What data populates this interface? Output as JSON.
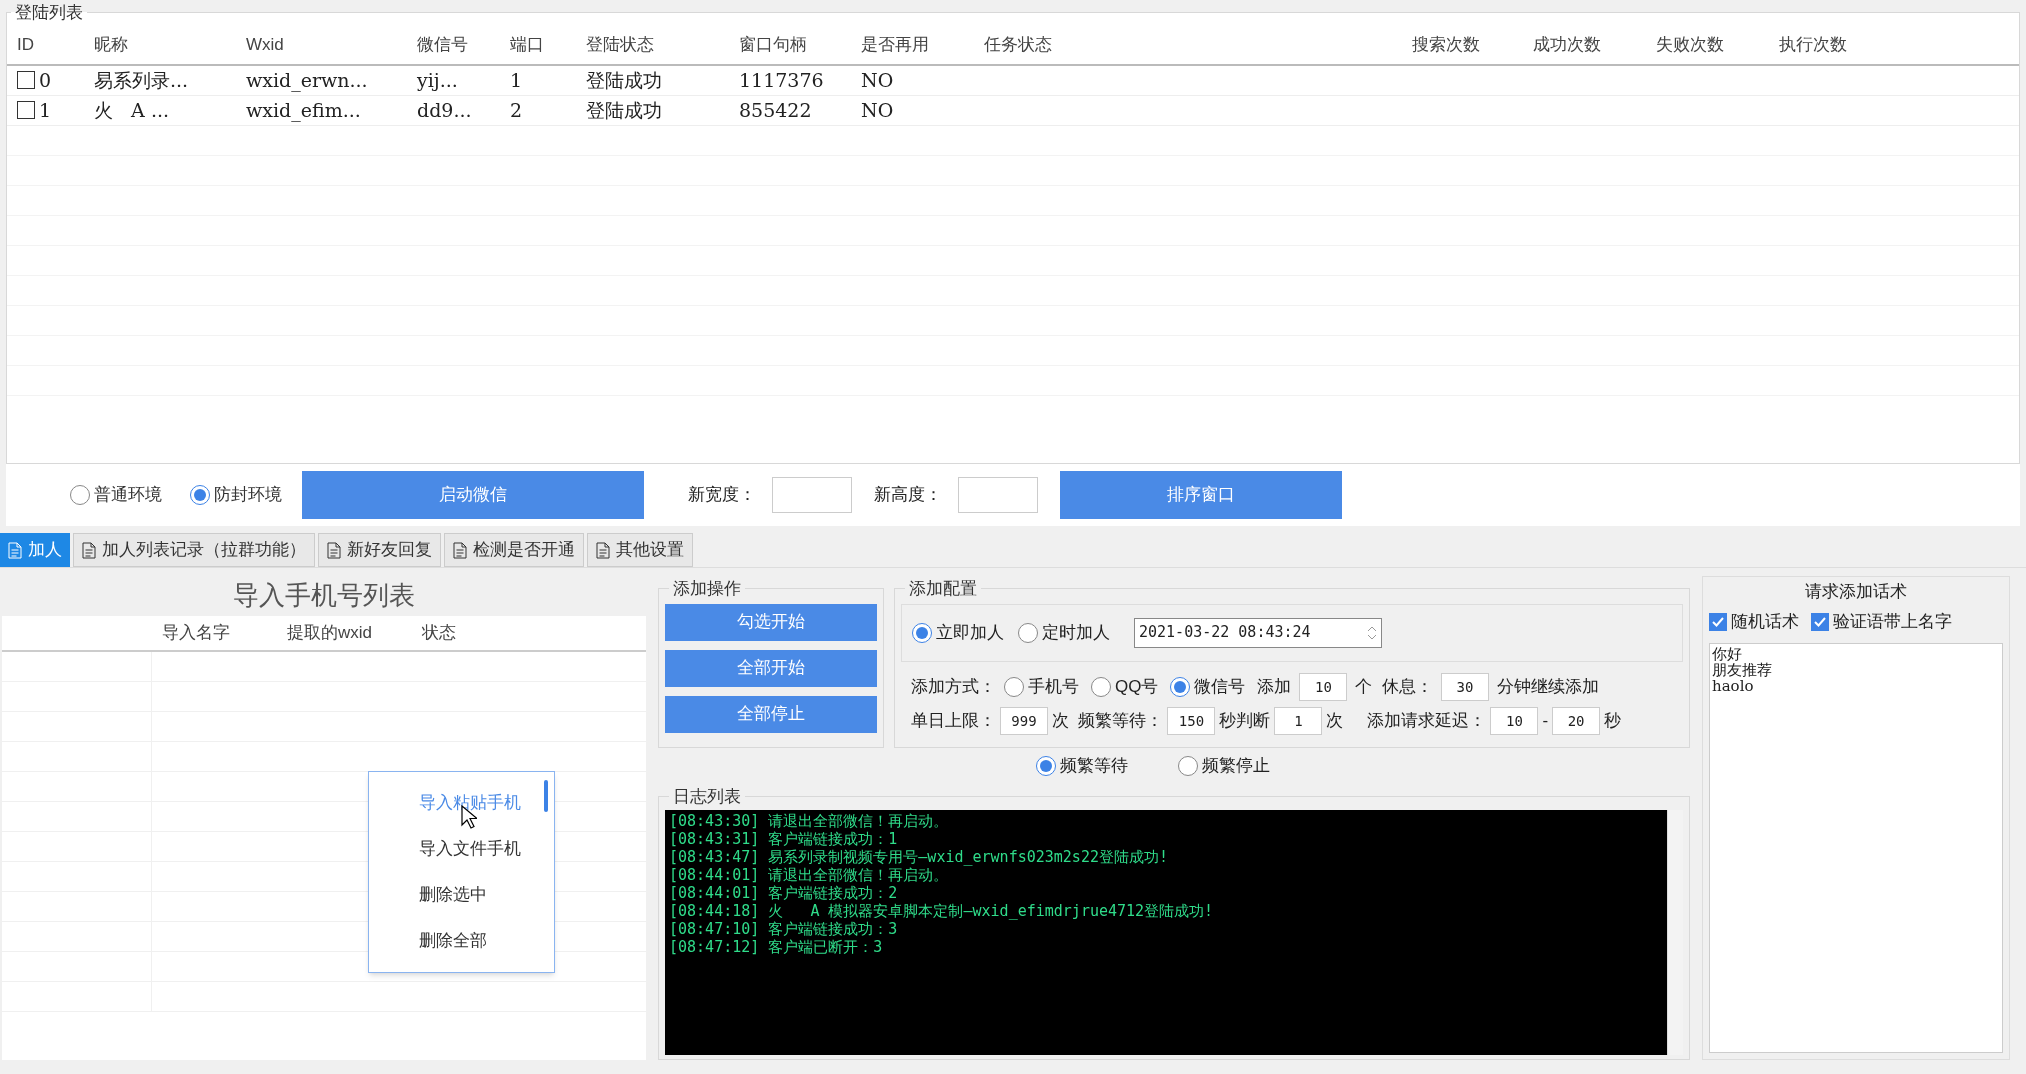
{
  "login_list": {
    "title": "登陆列表",
    "columns": [
      "ID",
      "昵称",
      "Wxid",
      "微信号",
      "端口",
      "登陆状态",
      "窗口句柄",
      "是否再用",
      "任务状态",
      "搜索次数",
      "成功次数",
      "失败次数",
      "执行次数"
    ],
    "rows": [
      {
        "checked": false,
        "cells": [
          "0",
          "易系列录...",
          "wxid_erwn...",
          "yij...",
          "1",
          "登陆成功",
          "1117376",
          "NO",
          "",
          "",
          "",
          "",
          ""
        ]
      },
      {
        "checked": false,
        "cells": [
          "1",
          "火   A ...",
          "wxid_efim...",
          "dd9...",
          "2",
          "登陆成功",
          "855422",
          "NO",
          "",
          "",
          "",
          "",
          ""
        ]
      }
    ]
  },
  "env_options": [
    {
      "label": "普通环境",
      "selected": false
    },
    {
      "label": "防封环境",
      "selected": true
    }
  ],
  "start_button": "启动微信",
  "width_label": "新宽度：",
  "height_label": "新高度：",
  "sort_button": "排序窗口",
  "tabs": [
    {
      "label": "加人",
      "selected": true
    },
    {
      "label": "加人列表记录（拉群功能）",
      "selected": false
    },
    {
      "label": "新好友回复",
      "selected": false
    },
    {
      "label": "检测是否开通",
      "selected": false
    },
    {
      "label": "其他设置",
      "selected": false
    }
  ],
  "phone_list": {
    "title": "导入手机号列表",
    "columns": [
      "",
      "导入名字",
      "提取的wxid",
      "状态"
    ]
  },
  "context_menu": [
    {
      "label": "导入粘贴手机",
      "selected": true
    },
    {
      "label": "导入文件手机",
      "selected": false
    },
    {
      "label": "删除选中",
      "selected": false
    },
    {
      "label": "删除全部",
      "selected": false
    }
  ],
  "add_ops": {
    "title": "添加操作",
    "buttons": [
      "勾选开始",
      "全部开始",
      "全部停止"
    ]
  },
  "add_config": {
    "title": "添加配置",
    "timing": [
      {
        "label": "立即加人",
        "selected": true
      },
      {
        "label": "定时加人",
        "selected": false
      }
    ],
    "datetime": "2021-03-22 08:43:24",
    "method_label": "添加方式：",
    "methods": [
      {
        "label": "手机号",
        "selected": false
      },
      {
        "label": "QQ号",
        "selected": false
      },
      {
        "label": "微信号",
        "selected": true
      }
    ],
    "row1": [
      {
        "kind": "text",
        "text": "添加"
      },
      {
        "kind": "input",
        "value": "10"
      },
      {
        "kind": "text",
        "text": "个  休息："
      },
      {
        "kind": "input",
        "value": "30"
      },
      {
        "kind": "text",
        "text": "分钟继续添加"
      }
    ],
    "row2": [
      {
        "kind": "text",
        "text": "单日上限："
      },
      {
        "kind": "input",
        "value": "999"
      },
      {
        "kind": "text",
        "text": "次  频繁等待："
      },
      {
        "kind": "input",
        "value": "150"
      },
      {
        "kind": "text",
        "text": "秒判断"
      },
      {
        "kind": "input",
        "value": "1"
      },
      {
        "kind": "text",
        "text": "次"
      },
      {
        "kind": "gap"
      },
      {
        "kind": "text",
        "text": "添加请求延迟："
      },
      {
        "kind": "input",
        "value": "10"
      },
      {
        "kind": "text",
        "text": "-"
      },
      {
        "kind": "input",
        "value": "20"
      },
      {
        "kind": "text",
        "text": "秒"
      }
    ]
  },
  "freq_options": [
    {
      "label": "频繁等待",
      "selected": true
    },
    {
      "label": "频繁停止",
      "selected": false
    }
  ],
  "log": {
    "title": "日志列表",
    "lines": [
      "[08:43:30] 请退出全部微信！再启动。",
      "[08:43:31] 客户端链接成功：1",
      "[08:43:47] 易系列录制视频专用号—wxid_erwnfs023m2s22登陆成功!",
      "[08:44:01] 请退出全部微信！再启动。",
      "[08:44:01] 客户端链接成功：2",
      "[08:44:18] 火   A 模拟器安卓脚本定制—wxid_efimdrjrue4712登陆成功!",
      "[08:47:10] 客户端链接成功：3",
      "[08:47:12] 客户端已断开：3"
    ]
  },
  "phrases": {
    "title": "请求添加话术",
    "options": [
      {
        "label": "随机话术",
        "checked": true
      },
      {
        "label": "验证语带上名字",
        "checked": true
      }
    ],
    "lines": [
      "你好",
      "朋友推荐",
      "haolo"
    ]
  }
}
